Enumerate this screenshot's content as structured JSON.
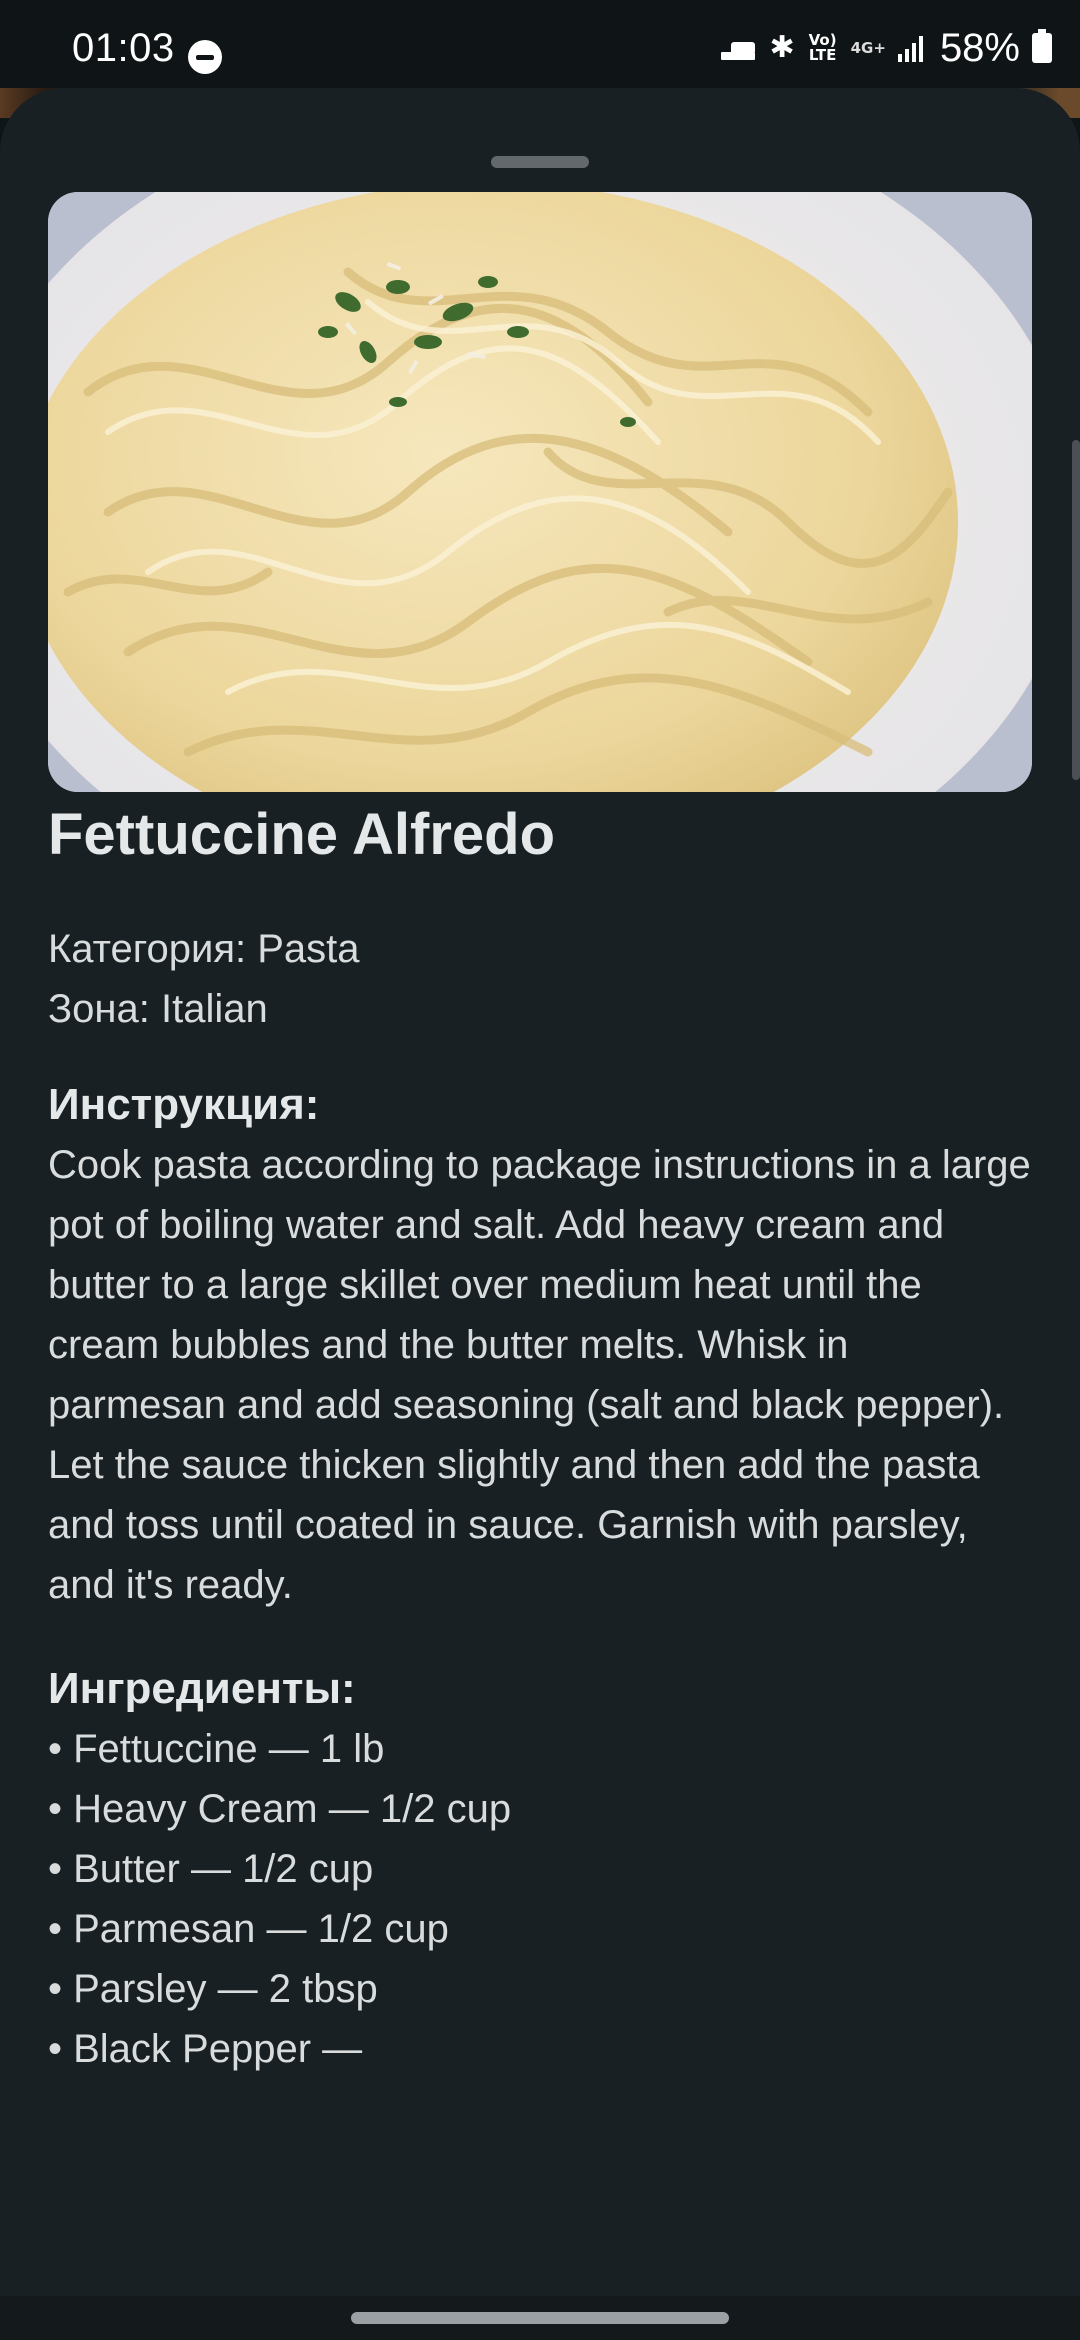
{
  "status_bar": {
    "time": "01:03",
    "lte_label": "Vo) LTE",
    "network_label": "4G+",
    "battery_percent": "58%",
    "icons": [
      "do-not-disturb-icon",
      "sleep-icon",
      "bluetooth-icon",
      "volte-icon",
      "4g-plus-icon",
      "signal-icon",
      "battery-charging-icon"
    ]
  },
  "meal": {
    "title": "Fettuccine Alfredo",
    "category": "Категория: Pasta",
    "area": "Зона: Italian",
    "instructions_header": "Инструкция:",
    "instructions": "Cook pasta according to package instructions in a large pot of boiling water and salt. Add heavy cream and butter to a large skillet over medium heat until the cream bubbles and the butter melts. Whisk in parmesan and add seasoning (salt and black pepper). Let the sauce thicken slightly and then add the pasta and toss until coated in sauce. Garnish with parsley, and it's ready.",
    "ingredients_header": "Ингредиенты:",
    "ingredients": [
      "• Fettuccine — 1 lb",
      "• Heavy Cream — 1/2 cup",
      "• Butter — 1/2 cup",
      "• Parmesan — 1/2 cup",
      "• Parsley — 2 tbsp",
      "• Black Pepper — "
    ]
  },
  "colors": {
    "sheet_background": "#192023",
    "screen_background": "#0f1416",
    "text": "#d8dcdd",
    "handle": "#62686b"
  }
}
